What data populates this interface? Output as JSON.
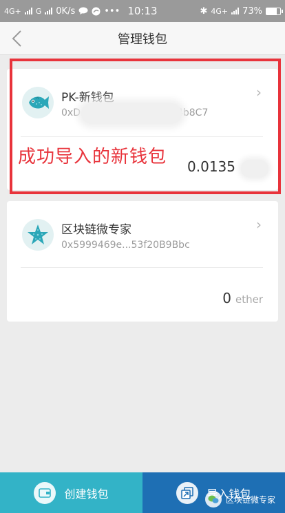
{
  "status_bar": {
    "net1": "4G+",
    "net2": "G",
    "speed": "0K/s",
    "dots": "•••",
    "time": "10:13",
    "bluetooth": "✱",
    "net3": "4G+",
    "battery": "73%",
    "battery_level": 0.73
  },
  "header": {
    "title": "管理钱包"
  },
  "wallets": [
    {
      "name": "PK-新钱包",
      "address": "0xD",
      "address_suffix": "4b8C7",
      "balance": "0.0135",
      "unit": ""
    },
    {
      "name": "区块链微专家",
      "address": "0x5999469e...53f20B9Bbc",
      "balance": "0",
      "unit": "ether"
    }
  ],
  "annotation": {
    "text": "成功导入的新钱包",
    "color": "#e8333b"
  },
  "bottom": {
    "create_label": "创建钱包",
    "import_label": "导入钱包",
    "create_color": "#33b3c7",
    "import_color": "#1e6fb4"
  },
  "watermark": {
    "text": "区块链微专家"
  },
  "icons": {
    "back": "chevron-left-icon",
    "arrow": "chevron-right-icon",
    "fish": "fish-icon",
    "starfish": "starfish-icon",
    "wallet": "wallet-icon",
    "import": "import-icon"
  }
}
